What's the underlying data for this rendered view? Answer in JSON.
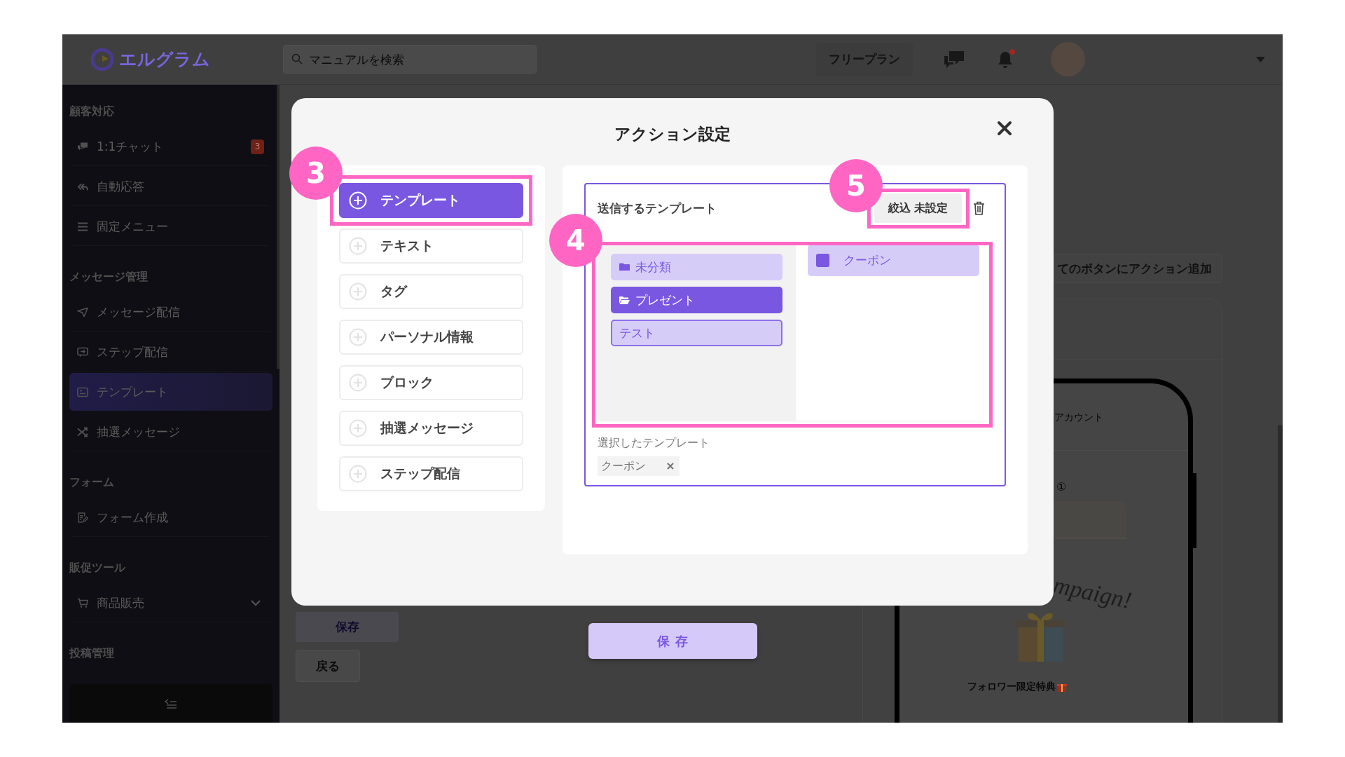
{
  "header": {
    "logo": "エルグラム",
    "search": {
      "placeholder": "マニュアルを検索"
    },
    "plan": "フリープラン",
    "bell": {
      "unread": true
    }
  },
  "sidebar": {
    "sections": [
      {
        "title": "顧客対応",
        "items": [
          {
            "label": "1:1チャット",
            "kind": "link",
            "badge": "3",
            "selected": false
          },
          {
            "label": "自動応答",
            "kind": "link",
            "selected": false
          },
          {
            "label": "固定メニュー",
            "kind": "link",
            "selected": false
          }
        ]
      },
      {
        "title": "メッセージ管理",
        "items": [
          {
            "label": "メッセージ配信",
            "kind": "link",
            "selected": false
          },
          {
            "label": "ステップ配信",
            "kind": "link",
            "selected": false
          },
          {
            "label": "テンプレート",
            "kind": "link",
            "selected": true
          },
          {
            "label": "抽選メッセージ",
            "kind": "link",
            "selected": false
          }
        ]
      },
      {
        "title": "フォーム",
        "items": [
          {
            "label": "フォーム作成",
            "kind": "link",
            "selected": false
          }
        ]
      },
      {
        "title": "販促ツール",
        "items": [
          {
            "label": "商品販売",
            "kind": "group",
            "selected": false
          }
        ]
      },
      {
        "title": "投稿管理"
      }
    ]
  },
  "page": {
    "save": "保存",
    "back": "戻る",
    "add_action": "てのボタンにアクション追加",
    "preview": {
      "account": "アカウント",
      "number": "①",
      "campaign": "mpaign!",
      "caption": "フォロワー限定特典"
    }
  },
  "modal": {
    "title": "アクション設定",
    "actions": [
      {
        "label": "テンプレート",
        "selected": true,
        "callout": "3"
      },
      {
        "label": "テキスト",
        "selected": false
      },
      {
        "label": "タグ",
        "selected": false
      },
      {
        "label": "パーソナル情報",
        "selected": false
      },
      {
        "label": "ブロック",
        "selected": false
      },
      {
        "label": "抽選メッセージ",
        "selected": false
      },
      {
        "label": "ステップ配信",
        "selected": false
      }
    ],
    "template_box": {
      "title": "送信するテンプレート",
      "filter": {
        "label": "絞込 未設定",
        "callout": "5"
      },
      "picker_callout": "4",
      "folders": [
        {
          "label": "未分類",
          "kind": "folder",
          "selected": false,
          "focused": false
        },
        {
          "label": "プレゼント",
          "kind": "folder",
          "selected": true,
          "focused": false
        },
        {
          "label": "テスト",
          "kind": "plain",
          "selected": false,
          "focused": true
        }
      ],
      "templates": [
        {
          "label": "クーポン",
          "selected": true,
          "checked": true
        }
      ],
      "selected_label": "選択したテンプレート",
      "selected_templates": [
        {
          "label": "クーポン"
        }
      ]
    },
    "save": "保存"
  }
}
